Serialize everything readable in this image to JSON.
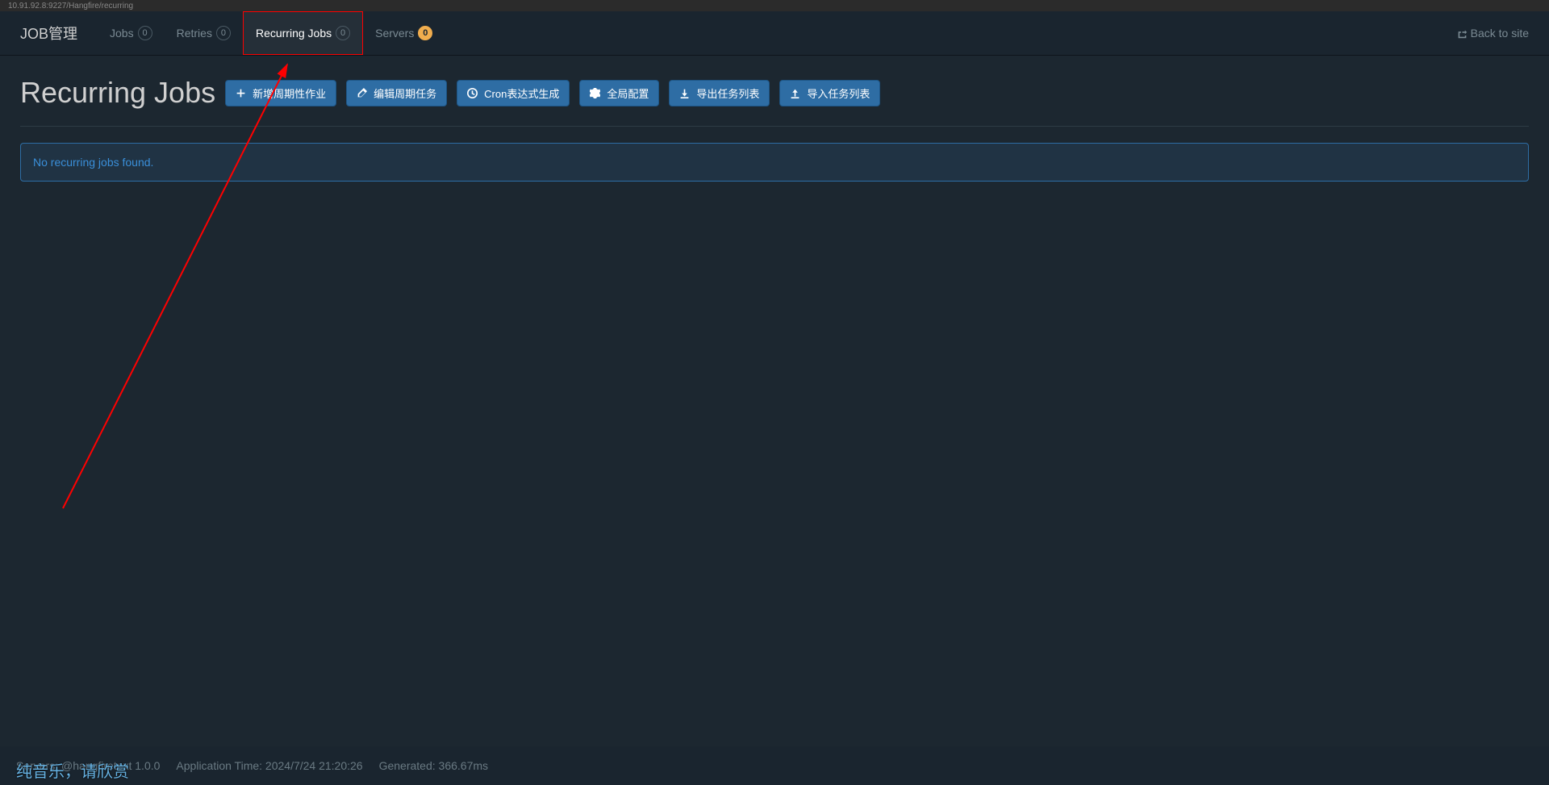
{
  "url_fragment": "10.91.92.8:9227/Hangfire/recurring",
  "brand": "JOB管理",
  "nav": {
    "jobs": {
      "label": "Jobs",
      "count": "0"
    },
    "retries": {
      "label": "Retries",
      "count": "0"
    },
    "recurring": {
      "label": "Recurring Jobs",
      "count": "0"
    },
    "servers": {
      "label": "Servers",
      "count": "0"
    }
  },
  "back_to_site": "Back to site",
  "page_title": "Recurring Jobs",
  "buttons": {
    "create": "新增周期性作业",
    "edit": "编辑周期任务",
    "cron": "Cron表达式生成",
    "config": "全局配置",
    "export": "导出任务列表",
    "import": "导入任务列表"
  },
  "alert_message": "No recurring jobs found.",
  "footer": {
    "servers_label": "Servers:",
    "servers_value": "@hangfiretext 1.0.0",
    "app_time": "Application Time: 2024/7/24 21:20:26",
    "generated": "Generated: 366.67ms"
  },
  "music_caption": "纯音乐，请欣赏"
}
